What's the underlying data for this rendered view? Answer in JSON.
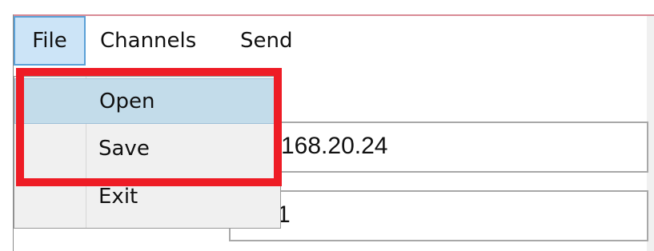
{
  "menubar": {
    "file_label": "File",
    "channels_label": "Channels",
    "send_label": "Send"
  },
  "file_menu": {
    "items": [
      {
        "label": "Open"
      },
      {
        "label": "Save"
      },
      {
        "label": "Exit"
      }
    ]
  },
  "fields": {
    "ip_value": "168.20.24",
    "port_value": "1"
  },
  "colors": {
    "highlight": "#ee1c25",
    "selected_menu": "#cce4f7",
    "hover_item": "#c3dcea"
  }
}
